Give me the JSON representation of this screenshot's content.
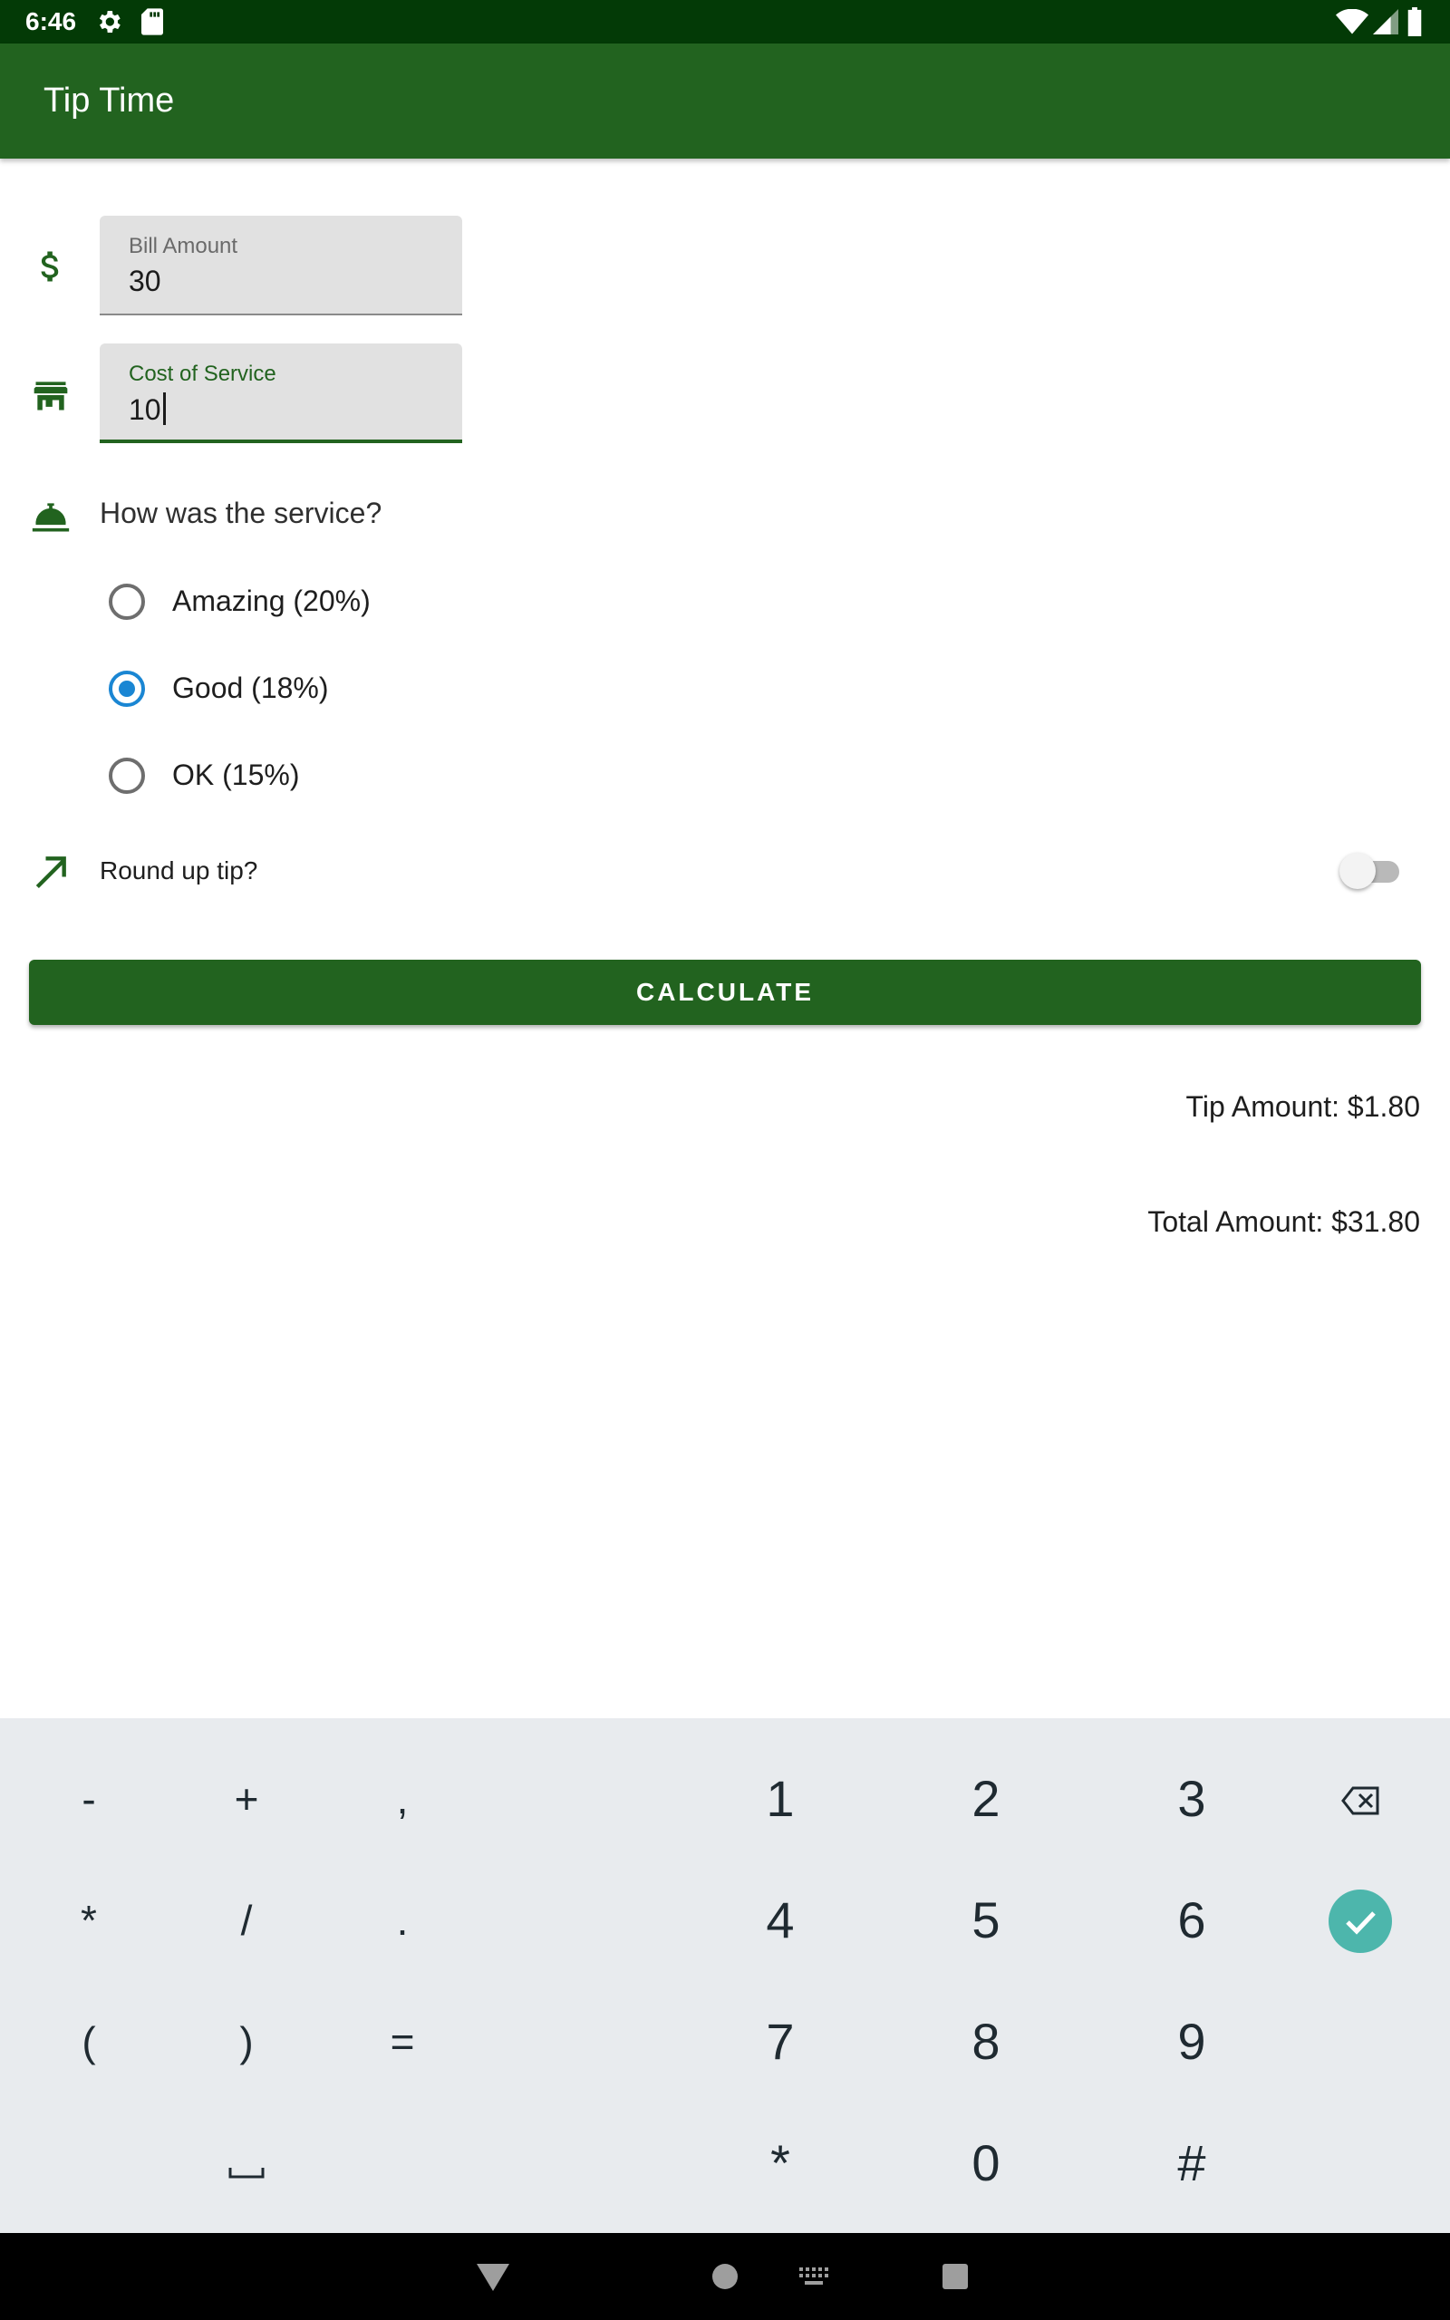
{
  "status_bar": {
    "time": "6:46",
    "icons": [
      "settings-icon",
      "sd-card-icon",
      "wifi-icon",
      "signal-icon",
      "battery-icon"
    ]
  },
  "app_bar": {
    "title": "Tip Time"
  },
  "bill_amount": {
    "label": "Bill Amount",
    "value": "30",
    "icon": "dollar-icon"
  },
  "cost_of_service": {
    "label": "Cost of Service",
    "value": "10",
    "icon": "storefront-icon"
  },
  "service_question": {
    "text": "How was the service?",
    "icon": "room-service-icon"
  },
  "tip_options": [
    {
      "label": "Amazing (20%)",
      "checked": false
    },
    {
      "label": "Good (18%)",
      "checked": true
    },
    {
      "label": "OK (15%)",
      "checked": false
    }
  ],
  "round_up": {
    "label": "Round up tip?",
    "enabled": false,
    "icon": "trending-up-arrow-icon"
  },
  "calculate_button": {
    "label": "CALCULATE"
  },
  "results": {
    "tip_amount": "Tip Amount: $1.80",
    "total_amount": "Total Amount: $31.80"
  },
  "keyboard": {
    "left_keys": [
      "-",
      "+",
      ",",
      "*",
      "/",
      ".",
      "(",
      ")",
      "="
    ],
    "space_key": "␣",
    "number_keys": [
      "1",
      "2",
      "3",
      "4",
      "5",
      "6",
      "7",
      "8",
      "9",
      "*",
      "0",
      "#"
    ],
    "backspace_icon": "backspace-icon",
    "done_icon": "checkmark-icon"
  },
  "colors": {
    "primary": "#22631f",
    "status_bar": "#033a06",
    "radio_accent": "#1a86d3",
    "done_key": "#4db6ac",
    "keyboard_bg": "#e8ebee"
  }
}
